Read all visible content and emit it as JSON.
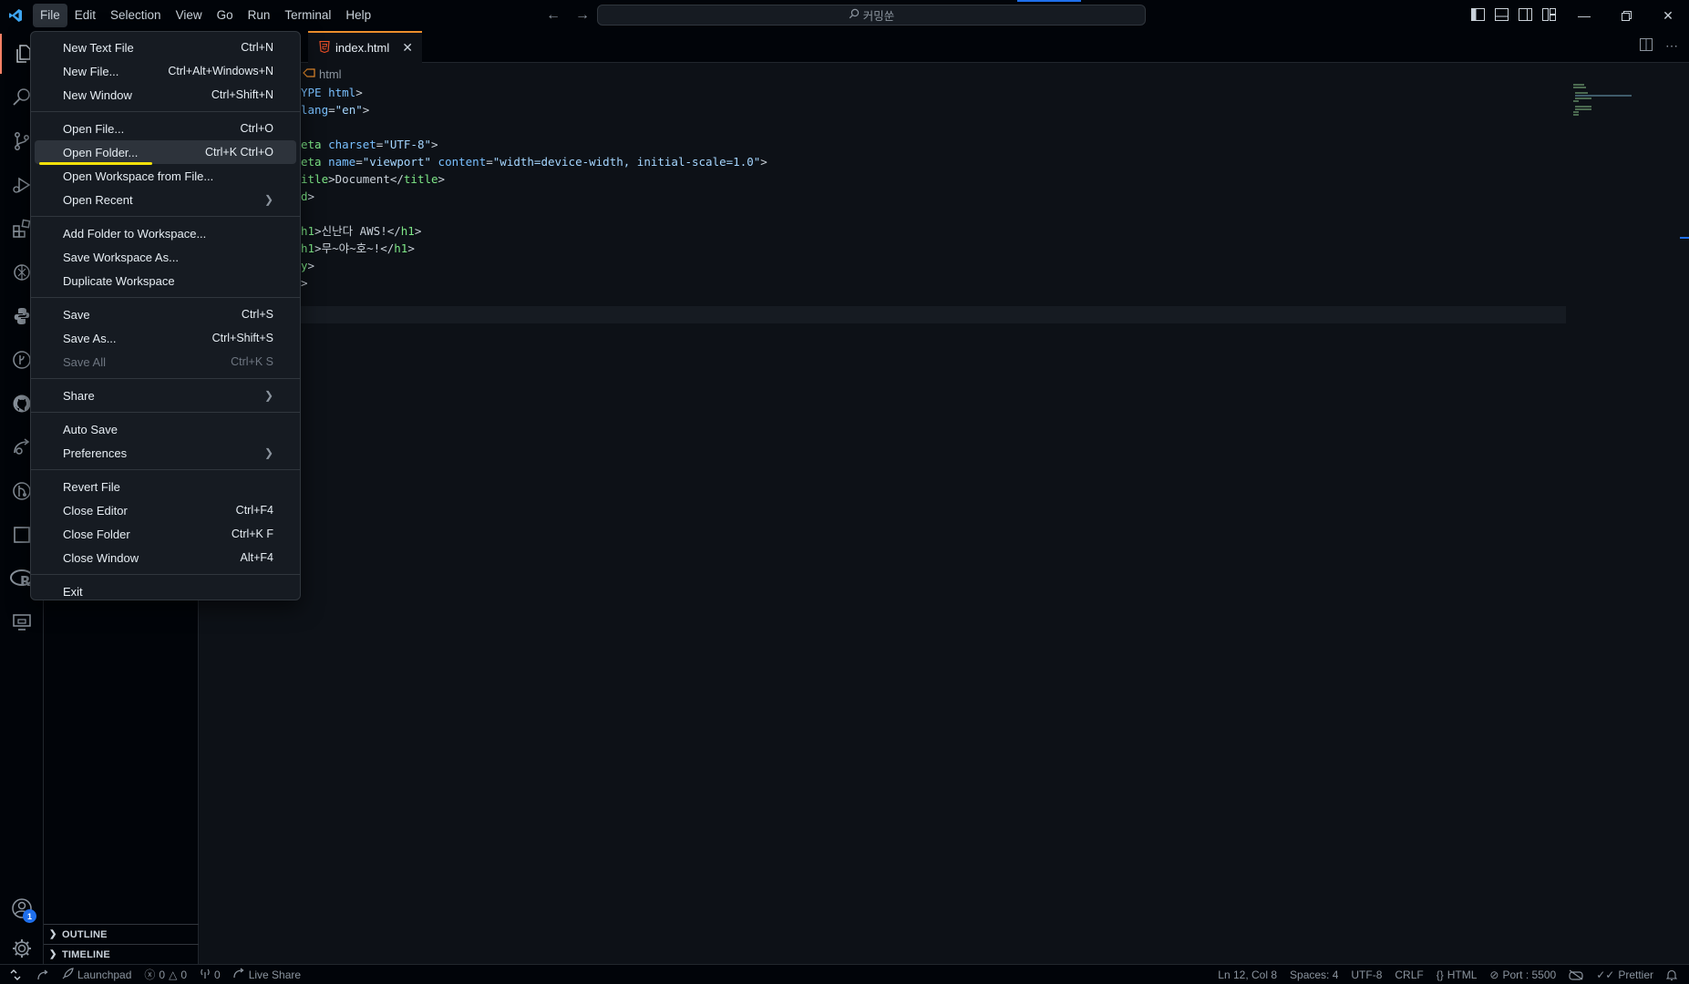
{
  "menubar": {
    "items": [
      "File",
      "Edit",
      "Selection",
      "View",
      "Go",
      "Run",
      "Terminal",
      "Help"
    ]
  },
  "command_center": {
    "text": "커밍쑨"
  },
  "file_menu": {
    "groups": [
      [
        {
          "label": "New Text File",
          "shortcut": "Ctrl+N"
        },
        {
          "label": "New File...",
          "shortcut": "Ctrl+Alt+Windows+N"
        },
        {
          "label": "New Window",
          "shortcut": "Ctrl+Shift+N"
        }
      ],
      [
        {
          "label": "Open File...",
          "shortcut": "Ctrl+O"
        },
        {
          "label": "Open Folder...",
          "shortcut": "Ctrl+K Ctrl+O"
        },
        {
          "label": "Open Workspace from File...",
          "shortcut": ""
        },
        {
          "label": "Open Recent",
          "shortcut": ""
        }
      ],
      [
        {
          "label": "Add Folder to Workspace...",
          "shortcut": ""
        },
        {
          "label": "Save Workspace As...",
          "shortcut": ""
        },
        {
          "label": "Duplicate Workspace",
          "shortcut": ""
        }
      ],
      [
        {
          "label": "Save",
          "shortcut": "Ctrl+S"
        },
        {
          "label": "Save As...",
          "shortcut": "Ctrl+Shift+S"
        },
        {
          "label": "Save All",
          "shortcut": "Ctrl+K S"
        }
      ],
      [
        {
          "label": "Share",
          "shortcut": ""
        }
      ],
      [
        {
          "label": "Auto Save",
          "shortcut": ""
        },
        {
          "label": "Preferences",
          "shortcut": ""
        }
      ],
      [
        {
          "label": "Revert File",
          "shortcut": ""
        },
        {
          "label": "Close Editor",
          "shortcut": "Ctrl+F4"
        },
        {
          "label": "Close Folder",
          "shortcut": "Ctrl+K F"
        },
        {
          "label": "Close Window",
          "shortcut": "Alt+F4"
        }
      ],
      [
        {
          "label": "Exit",
          "shortcut": ""
        }
      ]
    ]
  },
  "tab": {
    "label": "index.html"
  },
  "breadcrumb": {
    "label": "html"
  },
  "code_lines": [
    [
      {
        "t": "YPE ",
        "c": "tk-kw"
      },
      {
        "t": "html",
        "c": "tk-attr"
      },
      {
        "t": ">",
        "c": "tk-pun"
      }
    ],
    [
      {
        "t": "lang",
        "c": "tk-attr"
      },
      {
        "t": "=",
        "c": "tk-pun"
      },
      {
        "t": "\"en\"",
        "c": "tk-str"
      },
      {
        "t": ">",
        "c": "tk-pun"
      }
    ],
    [
      {
        "t": "",
        "c": "tk-pun"
      }
    ],
    [
      {
        "t": "eta ",
        "c": "tk-tag"
      },
      {
        "t": "charset",
        "c": "tk-attr"
      },
      {
        "t": "=",
        "c": "tk-pun"
      },
      {
        "t": "\"UTF-8\"",
        "c": "tk-str"
      },
      {
        "t": ">",
        "c": "tk-pun"
      }
    ],
    [
      {
        "t": "eta ",
        "c": "tk-tag"
      },
      {
        "t": "name",
        "c": "tk-attr"
      },
      {
        "t": "=",
        "c": "tk-pun"
      },
      {
        "t": "\"viewport\" ",
        "c": "tk-str"
      },
      {
        "t": "content",
        "c": "tk-attr"
      },
      {
        "t": "=",
        "c": "tk-pun"
      },
      {
        "t": "\"width=device-width, initial-scale=1.0\"",
        "c": "tk-str"
      },
      {
        "t": ">",
        "c": "tk-pun"
      }
    ],
    [
      {
        "t": "itle",
        "c": "tk-tag"
      },
      {
        "t": ">Document</",
        "c": "tk-pun"
      },
      {
        "t": "title",
        "c": "tk-tag"
      },
      {
        "t": ">",
        "c": "tk-pun"
      }
    ],
    [
      {
        "t": "d",
        "c": "tk-tag"
      },
      {
        "t": ">",
        "c": "tk-pun"
      }
    ],
    [
      {
        "t": "",
        "c": "tk-pun"
      }
    ],
    [
      {
        "t": "h1",
        "c": "tk-tag"
      },
      {
        "t": ">신난다 AWS!</",
        "c": "tk-pun"
      },
      {
        "t": "h1",
        "c": "tk-tag"
      },
      {
        "t": ">",
        "c": "tk-pun"
      }
    ],
    [
      {
        "t": "h1",
        "c": "tk-tag"
      },
      {
        "t": ">무~야~호~!</",
        "c": "tk-pun"
      },
      {
        "t": "h1",
        "c": "tk-tag"
      },
      {
        "t": ">",
        "c": "tk-pun"
      }
    ],
    [
      {
        "t": "y",
        "c": "tk-tag"
      },
      {
        "t": ">",
        "c": "tk-pun"
      }
    ],
    [
      {
        "t": ">",
        "c": "tk-pun"
      }
    ]
  ],
  "sidebar": {
    "outline": "OUTLINE",
    "timeline": "TIMELINE"
  },
  "activity_badge": "1",
  "statusbar": {
    "launchpad": "Launchpad",
    "errors": "0",
    "warnings": "0",
    "ports": "0",
    "live_share": "Live Share",
    "position": "Ln 12, Col 8",
    "spaces": "Spaces: 4",
    "encoding": "UTF-8",
    "eol": "CRLF",
    "language": "HTML",
    "port": "Port : 5500",
    "prettier": "Prettier"
  },
  "colors": {
    "accent": "#1f6feb",
    "highlight_underline": "#f5e10a",
    "tab_accent": "#ec8e2c"
  }
}
